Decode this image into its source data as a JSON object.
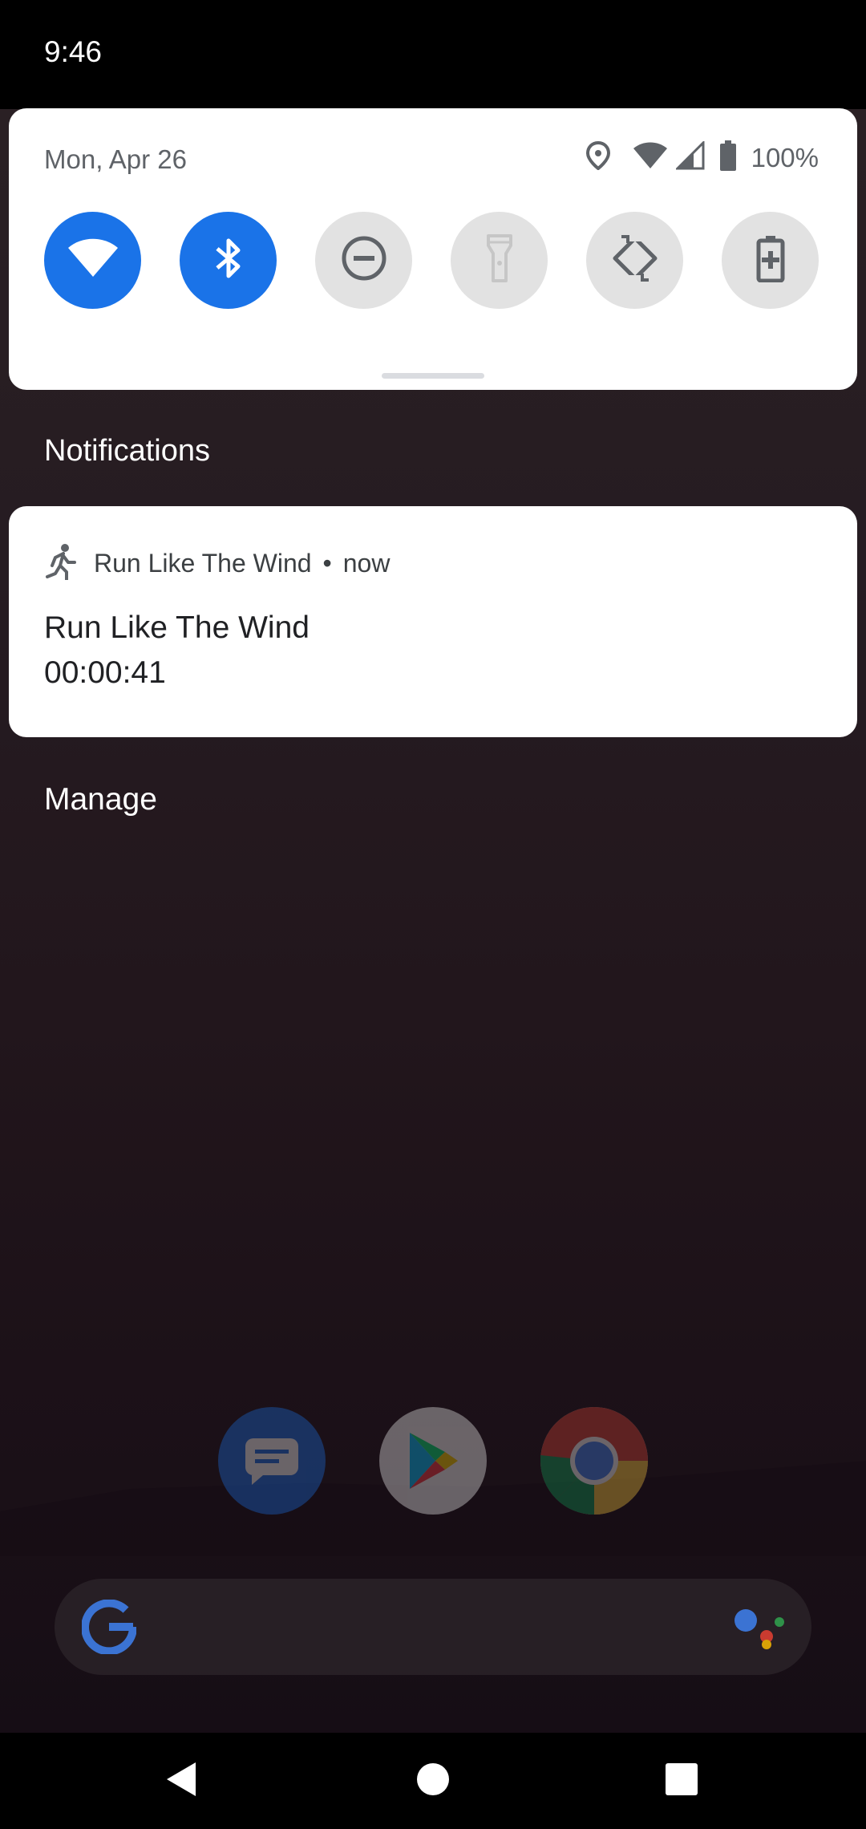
{
  "status_bar": {
    "time": "9:46"
  },
  "quick_settings": {
    "date": "Mon, Apr 26",
    "battery_percent": "100%",
    "tiles": [
      {
        "icon": "wifi-icon",
        "state": "on"
      },
      {
        "icon": "bluetooth-icon",
        "state": "on"
      },
      {
        "icon": "do-not-disturb-icon",
        "state": "off"
      },
      {
        "icon": "flashlight-icon",
        "state": "off"
      },
      {
        "icon": "auto-rotate-icon",
        "state": "off"
      },
      {
        "icon": "battery-saver-icon",
        "state": "off"
      }
    ],
    "accent_color": "#1a73e8"
  },
  "notifications": {
    "section_title": "Notifications",
    "items": [
      {
        "app_icon": "running-person-icon",
        "app_name": "Run Like The Wind",
        "separator": "•",
        "time": "now",
        "title": "Run Like The Wind",
        "text": "00:00:41"
      }
    ],
    "manage_label": "Manage"
  },
  "home_screen": {
    "dock_apps": [
      "messages-icon",
      "play-store-icon",
      "chrome-icon"
    ],
    "search": {
      "icons": [
        "google-g-icon",
        "assistant-icon"
      ]
    }
  },
  "nav_bar": {
    "buttons": [
      "back-icon",
      "home-icon",
      "recents-icon"
    ]
  }
}
